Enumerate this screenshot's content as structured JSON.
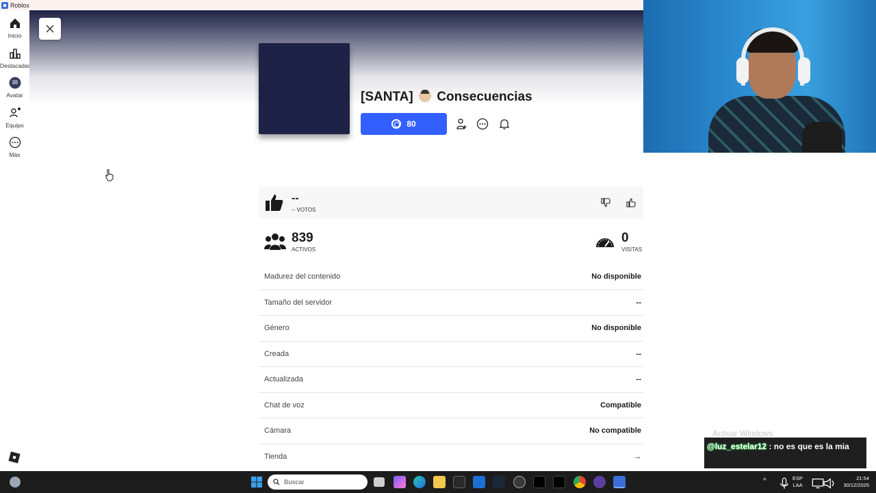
{
  "window": {
    "title": "Roblox"
  },
  "nav": {
    "items": [
      {
        "label": "Inicio"
      },
      {
        "label": "Destacadas"
      },
      {
        "label": "Avatar"
      },
      {
        "label": "Equipo"
      },
      {
        "label": "Más"
      }
    ]
  },
  "game": {
    "title_prefix": "[SANTA]",
    "title_name": "Consecuencias",
    "play_price": "80",
    "rating_value": "--",
    "votes_label": "-- VOTOS",
    "active_count": "839",
    "active_label": "ACTIVOS",
    "visits_count": "0",
    "visits_label": "VISITAS"
  },
  "details": [
    {
      "key": "Madurez del contenido",
      "value": "No disponible"
    },
    {
      "key": "Tamaño del servidor",
      "value": "--"
    },
    {
      "key": "Género",
      "value": "No disponible"
    },
    {
      "key": "Creada",
      "value": "--"
    },
    {
      "key": "Actualizada",
      "value": "--"
    },
    {
      "key": "Chat de voz",
      "value": "Compatible"
    },
    {
      "key": "Cámara",
      "value": "No compatible"
    },
    {
      "key": "Tienda",
      "value": "→"
    }
  ],
  "overlay": {
    "watermark": "Activar Windows",
    "chat_user": "@luz_estelar12",
    "chat_message": ": no es que es la mia"
  },
  "taskbar": {
    "search_placeholder": "Buscar",
    "lang_line1": "ESP",
    "lang_line2": "LAA",
    "time": "21:54",
    "date": "30/12/2025"
  },
  "colors": {
    "accent": "#335fff",
    "hero_top": "#1d2246",
    "taskbar": "#1c1c1c"
  }
}
